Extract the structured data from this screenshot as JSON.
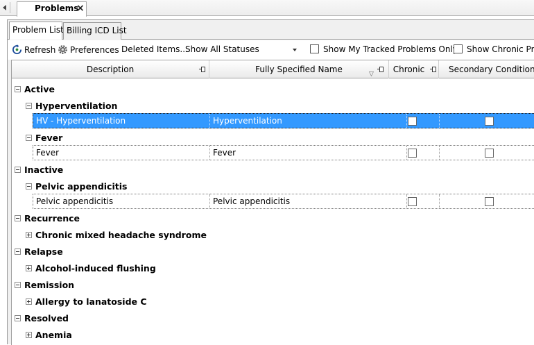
{
  "doc_tab": {
    "label": "Problems",
    "close": "×"
  },
  "sub_tabs": [
    {
      "label": "Problem List",
      "active": true
    },
    {
      "label": "Billing ICD List",
      "active": false
    }
  ],
  "toolbar": {
    "refresh_label": "Refresh",
    "preferences_label": "Preferences",
    "deleted_items_label": "Deleted Items...",
    "status_filter_value": "Show All Statuses",
    "tracked_only_label": "Show My Tracked Problems Only",
    "chronic_only_label": "Show Chronic Prob"
  },
  "columns": {
    "description": "Description",
    "fully_specified_name": "Fully Specified Name",
    "chronic": "Chronic",
    "secondary_condition": "Secondary Condition"
  },
  "groups": {
    "active": {
      "label": "Active",
      "problems": {
        "hyperventilation": {
          "label": "Hyperventilation",
          "row": {
            "description": "HV - Hyperventilation",
            "fsn": "Hyperventilation"
          }
        },
        "fever": {
          "label": "Fever",
          "row": {
            "description": "Fever",
            "fsn": "Fever"
          }
        }
      }
    },
    "inactive": {
      "label": "Inactive",
      "problems": {
        "pelvic": {
          "label": "Pelvic appendicitis",
          "row": {
            "description": "Pelvic appendicitis",
            "fsn": "Pelvic appendicitis"
          }
        }
      }
    },
    "recurrence": {
      "label": "Recurrence",
      "problem_label": "Chronic mixed headache syndrome"
    },
    "relapse": {
      "label": "Relapse",
      "problem_label": "Alcohol-induced flushing"
    },
    "remission": {
      "label": "Remission",
      "problem_label": "Allergy to lanatoside C"
    },
    "resolved": {
      "label": "Resolved",
      "problem_label": "Anemia"
    }
  },
  "colors": {
    "selected_row": "#3399ff"
  }
}
